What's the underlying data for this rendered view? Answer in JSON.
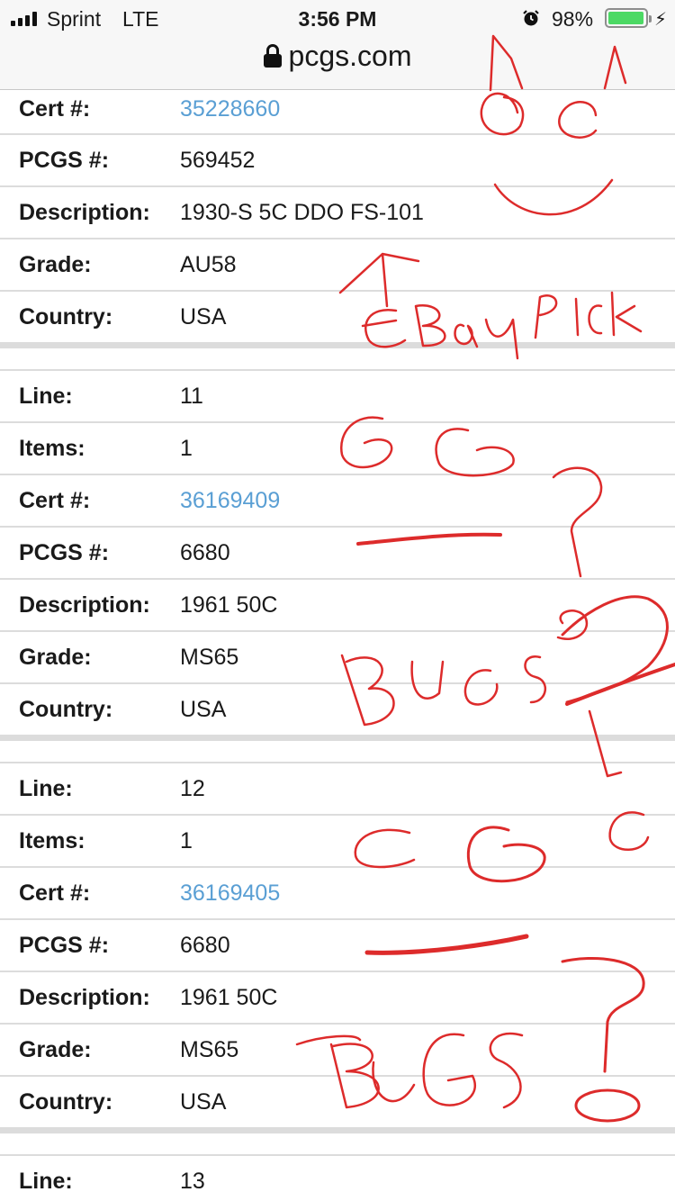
{
  "status_bar": {
    "carrier": "Sprint",
    "network": "LTE",
    "time": "3:56 PM",
    "battery_percent": "98%",
    "battery_level": 0.98,
    "signal_bars": 4
  },
  "browser": {
    "url": "pcgs.com"
  },
  "records": [
    {
      "rows": [
        {
          "label": "Cert #:",
          "value": "35228660",
          "link": true
        },
        {
          "label": "PCGS #:",
          "value": "569452"
        },
        {
          "label": "Description:",
          "value": "1930-S 5C DDO FS-101"
        },
        {
          "label": "Grade:",
          "value": "AU58"
        },
        {
          "label": "Country:",
          "value": "USA"
        }
      ]
    },
    {
      "rows": [
        {
          "label": "Line:",
          "value": "11"
        },
        {
          "label": "Items:",
          "value": "1"
        },
        {
          "label": "Cert #:",
          "value": "36169409",
          "link": true
        },
        {
          "label": "PCGS #:",
          "value": "6680"
        },
        {
          "label": "Description:",
          "value": "1961 50C"
        },
        {
          "label": "Grade:",
          "value": "MS65"
        },
        {
          "label": "Country:",
          "value": "USA"
        }
      ]
    },
    {
      "rows": [
        {
          "label": "Line:",
          "value": "12"
        },
        {
          "label": "Items:",
          "value": "1"
        },
        {
          "label": "Cert #:",
          "value": "36169405",
          "link": true
        },
        {
          "label": "PCGS #:",
          "value": "6680"
        },
        {
          "label": "Description:",
          "value": "1961 50C"
        },
        {
          "label": "Grade:",
          "value": "MS65"
        },
        {
          "label": "Country:",
          "value": "USA"
        }
      ]
    },
    {
      "rows": [
        {
          "label": "Line:",
          "value": "13"
        }
      ]
    }
  ],
  "annotations": {
    "ebay_pick": "eBay Pick",
    "bugs_1": "Bugs?",
    "bugs_2": "Bugs!",
    "color": "#dd2b2b"
  }
}
